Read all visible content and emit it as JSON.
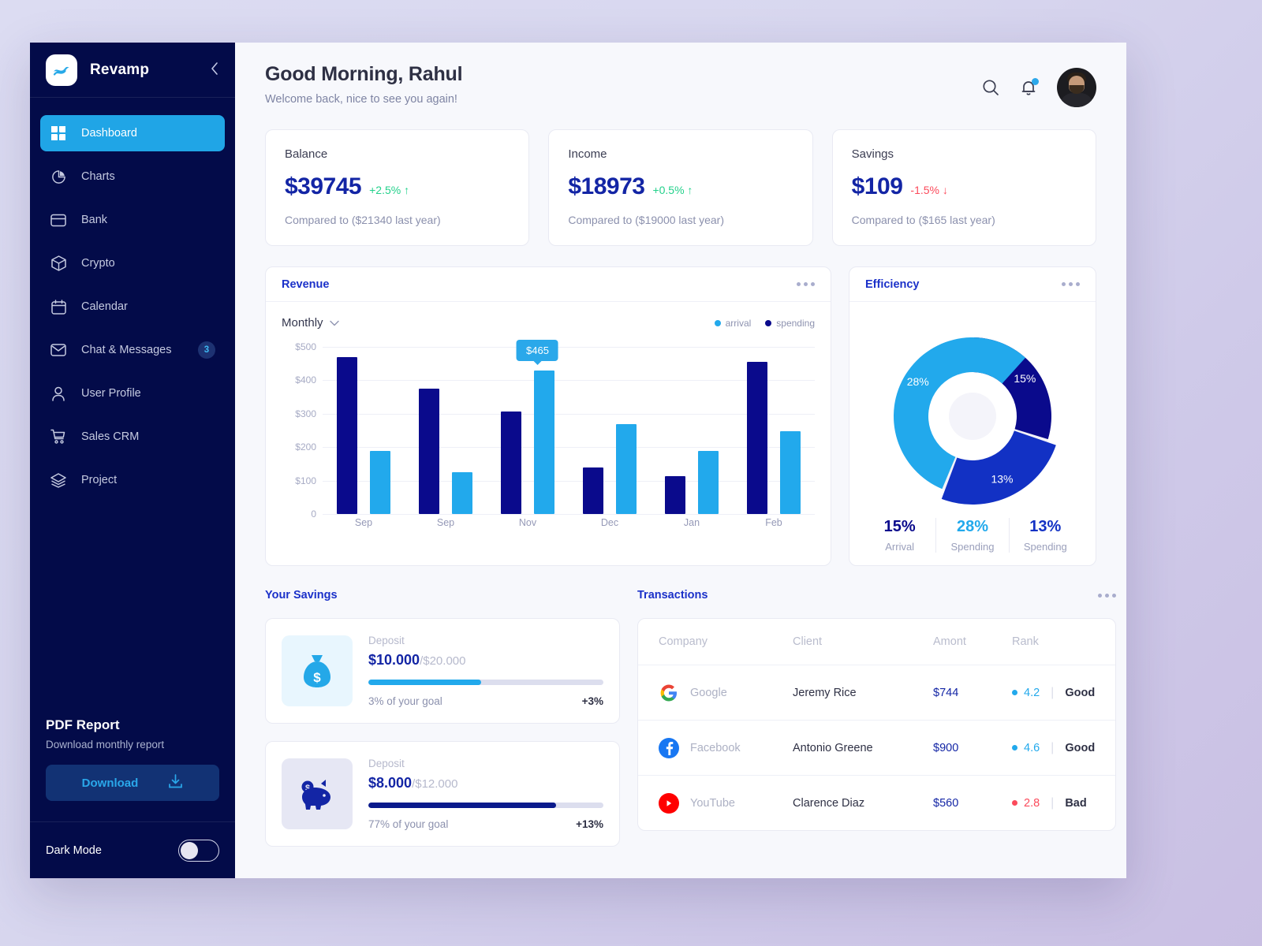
{
  "brand": {
    "name": "Revamp",
    "logo_icon": "wave-logo-icon",
    "collapse_icon": "chevron-left-icon"
  },
  "sidebar": {
    "items": [
      {
        "label": "Dashboard",
        "icon": "grid-icon",
        "active": true,
        "badge": ""
      },
      {
        "label": "Charts",
        "icon": "pie-chart-icon",
        "active": false,
        "badge": ""
      },
      {
        "label": "Bank",
        "icon": "credit-card-icon",
        "active": false,
        "badge": ""
      },
      {
        "label": "Crypto",
        "icon": "cube-icon",
        "active": false,
        "badge": ""
      },
      {
        "label": "Calendar",
        "icon": "calendar-icon",
        "active": false,
        "badge": ""
      },
      {
        "label": "Chat & Messages",
        "icon": "mail-icon",
        "active": false,
        "badge": "3"
      },
      {
        "label": "User Profile",
        "icon": "user-icon",
        "active": false,
        "badge": ""
      },
      {
        "label": "Sales CRM",
        "icon": "cart-icon",
        "active": false,
        "badge": ""
      },
      {
        "label": "Project",
        "icon": "layers-icon",
        "active": false,
        "badge": ""
      }
    ],
    "pdf": {
      "title": "PDF Report",
      "subtitle": "Download monthly report",
      "button_label": "Download",
      "button_icon": "download-icon"
    },
    "dark_mode": {
      "label": "Dark Mode",
      "enabled": false
    }
  },
  "header": {
    "greeting": "Good Morning, Rahul",
    "subtitle": "Welcome back, nice to see you again!",
    "search_icon": "search-icon",
    "bell_icon": "bell-icon",
    "avatar": "user-avatar",
    "has_notification": true
  },
  "stats": [
    {
      "label": "Balance",
      "value": "$39745",
      "delta": "+2.5%",
      "direction": "up",
      "arrow": "↑",
      "compare": "Compared to ($21340 last year)"
    },
    {
      "label": "Income",
      "value": "$18973",
      "delta": "+0.5%",
      "direction": "up",
      "arrow": "↑",
      "compare": "Compared to ($19000 last year)"
    },
    {
      "label": "Savings",
      "value": "$109",
      "delta": "-1.5%",
      "direction": "down",
      "arrow": "↓",
      "compare": "Compared to ($165 last year)"
    }
  ],
  "revenue": {
    "title": "Revenue",
    "menu_icon": "more-options-icon",
    "period": "Monthly",
    "period_icon": "chevron-down-icon",
    "tooltip": "$465"
  },
  "efficiency": {
    "title": "Efficiency",
    "menu_icon": "more-options-icon",
    "legend": [
      {
        "pct": "15%",
        "name": "Arrival",
        "color": "#0a0a8c"
      },
      {
        "pct": "28%",
        "name": "Spending",
        "color": "#22a9ec"
      },
      {
        "pct": "13%",
        "name": "Spending",
        "color": "#1231c4"
      }
    ]
  },
  "savings": {
    "title": "Your Savings",
    "cards": [
      {
        "icon": "money-bag-icon",
        "icon_bg": "#e8f6fe",
        "icon_color": "#24a8e8",
        "label": "Deposit",
        "amount": "$10.000",
        "goal": "/$20.000",
        "progress_pct": 48,
        "bar_color": "#22a9ec",
        "foot": "3% of your goal",
        "delta": "+3%"
      },
      {
        "icon": "piggy-bank-icon",
        "icon_bg": "#e6e7f4",
        "icon_color": "#1325a5",
        "label": "Deposit",
        "amount": "$8.000",
        "goal": "/$12.000",
        "progress_pct": 80,
        "bar_color": "#0a1a8c",
        "foot": "77% of your goal",
        "delta": "+13%"
      }
    ]
  },
  "transactions": {
    "title": "Transactions",
    "menu_icon": "more-options-icon",
    "columns": [
      "Company",
      "Client",
      "Amont",
      "Rank"
    ],
    "rows": [
      {
        "company": "Google",
        "logo": "google-icon",
        "client": "Jeremy Rice",
        "amount": "$744",
        "rank": "4.2",
        "rank_word": "Good",
        "rank_color": "#22a9ec"
      },
      {
        "company": "Facebook",
        "logo": "facebook-icon",
        "client": "Antonio Greene",
        "amount": "$900",
        "rank": "4.6",
        "rank_word": "Good",
        "rank_color": "#22a9ec"
      },
      {
        "company": "YouTube",
        "logo": "youtube-icon",
        "client": "Clarence Diaz",
        "amount": "$560",
        "rank": "2.8",
        "rank_word": "Bad",
        "rank_color": "#fb4a5b"
      }
    ]
  },
  "chart_data": [
    {
      "type": "bar",
      "title": "Revenue",
      "xlabel": "",
      "ylabel": "",
      "categories": [
        "Sep",
        "Sep",
        "Nov",
        "Dec",
        "Jan",
        "Feb"
      ],
      "ylim": [
        0,
        500
      ],
      "yticks": [
        0,
        100,
        200,
        300,
        400,
        500
      ],
      "ytick_labels": [
        "0",
        "$100",
        "$200",
        "$300",
        "$400",
        "$500"
      ],
      "grid": true,
      "legend_position": "top-right",
      "series": [
        {
          "name": "spending",
          "color": "#0a0a8c",
          "values": [
            470,
            375,
            307,
            140,
            113,
            455
          ]
        },
        {
          "name": "arrival",
          "color": "#22a9ec",
          "values": [
            188,
            126,
            430,
            268,
            188,
            248
          ]
        }
      ],
      "annotations": [
        {
          "text": "$465",
          "series": "arrival",
          "category_index": 2
        }
      ]
    },
    {
      "type": "pie",
      "title": "Efficiency",
      "subtitle": "",
      "labels": [
        "Arrival",
        "Spending",
        "Spending"
      ],
      "values": [
        15,
        28,
        13
      ],
      "value_labels": [
        "15%",
        "28%",
        "13%"
      ],
      "colors": [
        "#0a0a8c",
        "#22a9ec",
        "#1231c4"
      ],
      "track_color": "#f2f2f8",
      "donut": true,
      "legend_position": "bottom"
    }
  ]
}
